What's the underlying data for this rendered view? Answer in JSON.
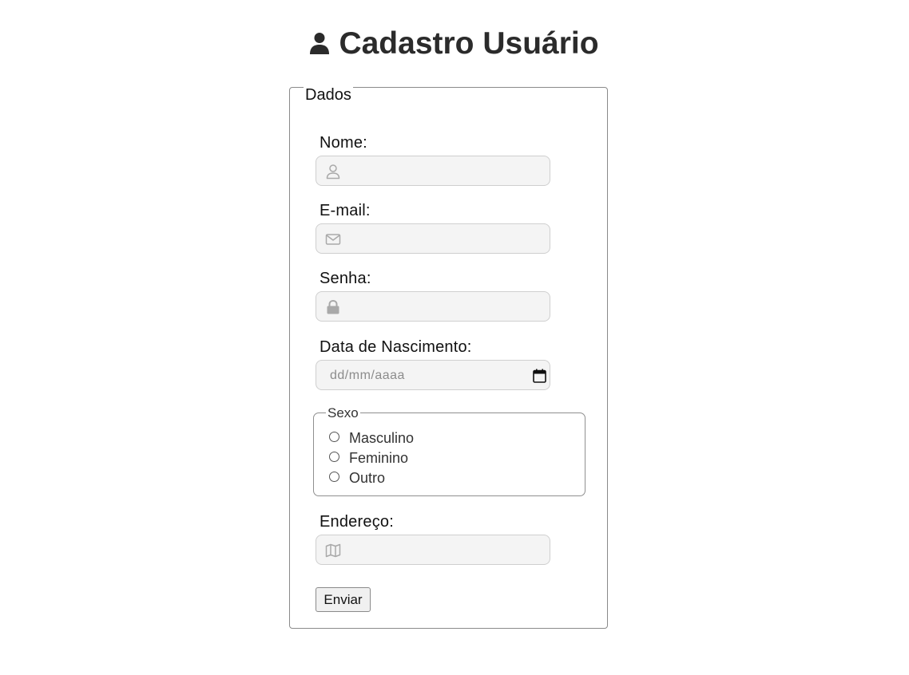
{
  "header": {
    "title": "Cadastro Usuário",
    "icon": "user-icon"
  },
  "form": {
    "legend": "Dados",
    "fields": {
      "nome": {
        "label": "Nome:",
        "value": "",
        "icon": "user-outline-icon"
      },
      "email": {
        "label": "E-mail:",
        "value": "",
        "icon": "envelope-icon"
      },
      "senha": {
        "label": "Senha:",
        "value": "",
        "icon": "lock-icon"
      },
      "nascimento": {
        "label": "Data de Nascimento:",
        "value": "dd/mm/aaaa",
        "icon": "calendar-icon"
      },
      "endereco": {
        "label": "Endereço:",
        "value": "",
        "icon": "map-icon"
      }
    },
    "sexo": {
      "legend": "Sexo",
      "options": [
        "Masculino",
        "Feminino",
        "Outro"
      ],
      "selected": null
    },
    "submit_label": "Enviar"
  },
  "colors": {
    "title": "#2b2b2b",
    "input_bg": "#f4f4f4",
    "input_border": "#cfcfcf",
    "icon": "#a9a9a9"
  }
}
